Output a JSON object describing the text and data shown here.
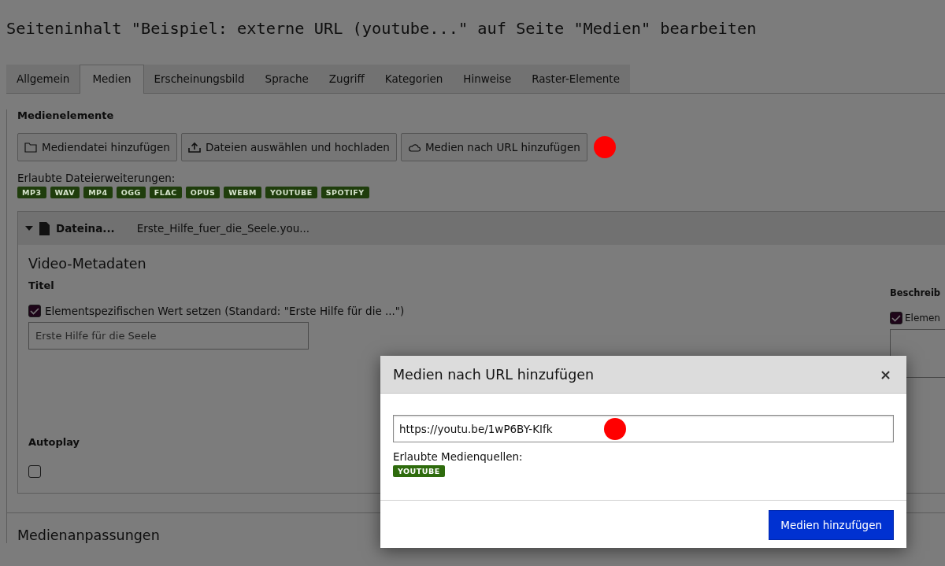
{
  "page_title": "Seiteninhalt \"Beispiel: externe URL (youtube...\" auf Seite \"Medien\" bearbeiten",
  "tabs": [
    {
      "label": "Allgemein",
      "selected": false
    },
    {
      "label": "Medien",
      "selected": true
    },
    {
      "label": "Erscheinungsbild",
      "selected": false
    },
    {
      "label": "Sprache",
      "selected": false
    },
    {
      "label": "Zugriff",
      "selected": false
    },
    {
      "label": "Kategorien",
      "selected": false
    },
    {
      "label": "Hinweise",
      "selected": false
    },
    {
      "label": "Raster-Elemente",
      "selected": false
    }
  ],
  "section_heading": "Medienelemente",
  "buttons": [
    {
      "label": "Mediendatei hinzufügen",
      "kind": "folder"
    },
    {
      "label": "Dateien auswählen und hochladen",
      "kind": "upload"
    },
    {
      "label": "Medien nach URL hinzufügen",
      "kind": "cloud"
    }
  ],
  "allowed_extensions": {
    "label": "Erlaubte Dateierweiterungen:",
    "tags": [
      "MP3",
      "WAV",
      "MP4",
      "OGG",
      "FLAC",
      "OPUS",
      "WEBM",
      "YOUTUBE",
      "SPOTIFY"
    ]
  },
  "file_panel": {
    "expanded": true,
    "field_label": "Dateina...",
    "file_name": "Erste_Hilfe_fuer_die_Seele.you...",
    "metadata_heading": "Video-Metadaten",
    "title_field": {
      "label": "Titel",
      "override_label": "Elementspezifischen Wert setzen (Standard: \"Erste Hilfe für die ...\")",
      "checked": true,
      "placeholder": "Erste Hilfe für die Seele"
    },
    "description_field": {
      "label": "Beschreib",
      "override_label": "Elemen",
      "checked": true
    },
    "autoplay": {
      "label": "Autoplay",
      "checked": false
    }
  },
  "next_section": "Medienanpassungen",
  "dialog": {
    "title": "Medien nach URL hinzufügen",
    "close": "×",
    "url_value": "https://youtu.be/1wP6BY-KIfk",
    "sources_label": "Erlaubte Medienquellen:",
    "sources": [
      "YOUTUBE"
    ],
    "submit": "Medien hinzufügen"
  }
}
